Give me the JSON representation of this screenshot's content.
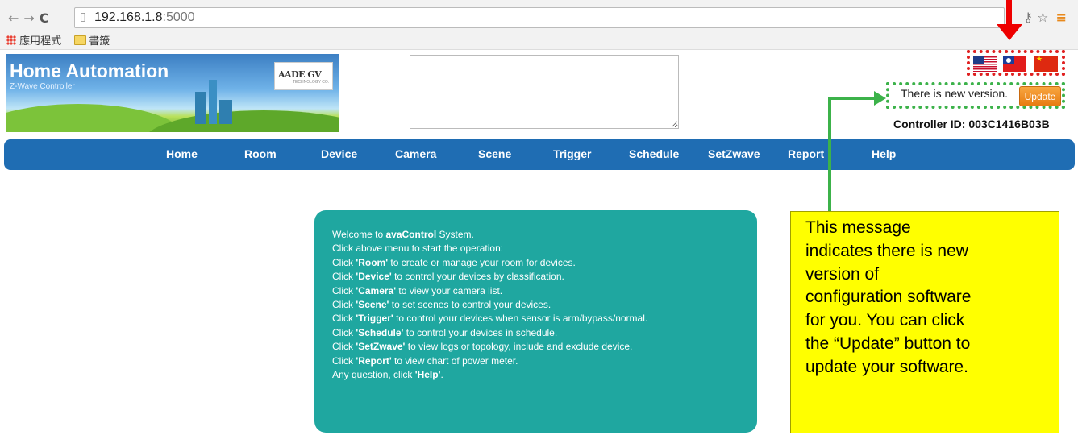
{
  "browser": {
    "url_host": "192.168.1.8",
    "url_port": ":5000",
    "bookmarks": [
      "應用程式",
      "書籤"
    ]
  },
  "banner": {
    "title": "Home Automation",
    "subtitle": "Z-Wave Controller",
    "logo_text": "AADE GV",
    "logo_sub": "TECHNOLOGY CO."
  },
  "header": {
    "new_version_text": "There is new version.",
    "update_label": "Update",
    "controller_id": "Controller ID: 003C1416B03B",
    "flags": [
      "us-flag-icon",
      "taiwan-flag-icon",
      "china-flag-icon"
    ]
  },
  "nav": [
    "Home",
    "Room",
    "Device",
    "Camera",
    "Scene",
    "Trigger",
    "Schedule",
    "SetZwave",
    "Report",
    "Help"
  ],
  "welcome": [
    {
      "pre": "Welcome to ",
      "b": "avaControl",
      "post": " System."
    },
    {
      "pre": "Click above menu to start the operation:",
      "b": "",
      "post": ""
    },
    {
      "pre": "Click ",
      "b": "'Room'",
      "post": " to create or manage your room for devices."
    },
    {
      "pre": "Click ",
      "b": "'Device'",
      "post": " to control your devices by classification."
    },
    {
      "pre": "Click ",
      "b": "'Camera'",
      "post": " to view your camera list."
    },
    {
      "pre": "Click ",
      "b": "'Scene'",
      "post": " to set scenes to control your devices."
    },
    {
      "pre": "Click ",
      "b": "'Trigger'",
      "post": " to control your devices when sensor is arm/bypass/normal."
    },
    {
      "pre": "Click ",
      "b": "'Schedule'",
      "post": " to control your devices in schedule."
    },
    {
      "pre": "Click ",
      "b": "'SetZwave'",
      "post": " to view logs or topology, include and exclude device."
    },
    {
      "pre": "Click ",
      "b": "'Report'",
      "post": " to view chart of power meter."
    },
    {
      "pre": "Any question, click ",
      "b": "'Help'",
      "post": "."
    }
  ],
  "note_lines": [
    "This message",
    "indicates there is new",
    "version of",
    "configuration software",
    "for you. You can click",
    "the “Update” button to",
    "update your software."
  ],
  "colors": {
    "nav_bg": "#1f6db3",
    "welcome_bg": "#1fa7a0",
    "note_bg": "#ffff00",
    "update_btn": "#e77c12",
    "annotation_red": "#e00000",
    "annotation_green": "#3cb24a"
  }
}
